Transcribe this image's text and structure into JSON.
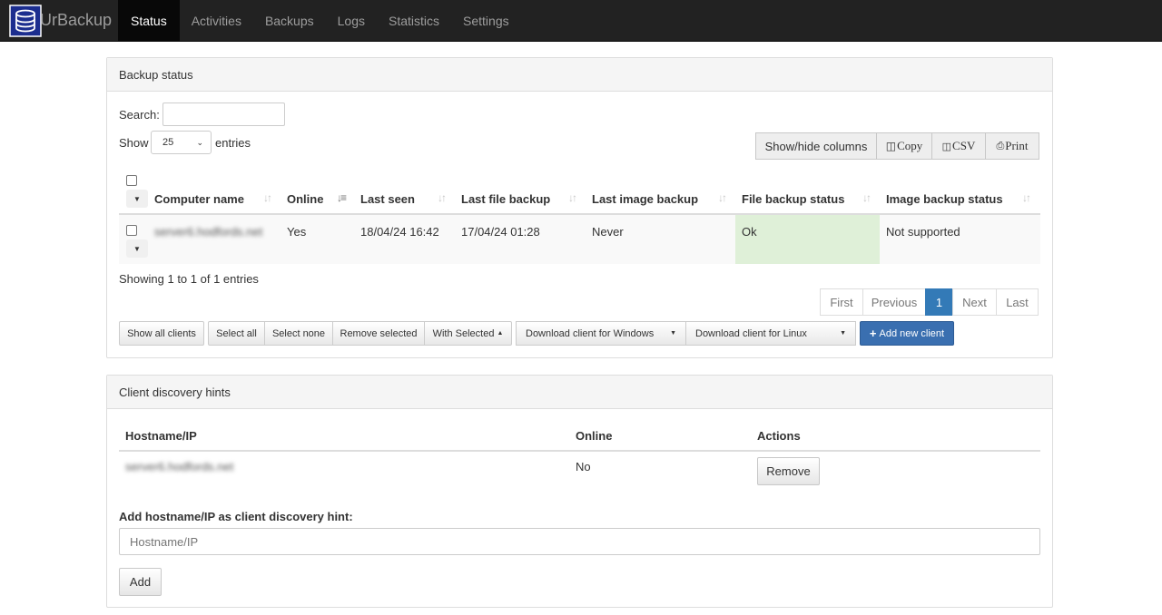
{
  "app": {
    "name": "UrBackup",
    "logo_icon": "database-icon"
  },
  "nav": {
    "items": [
      {
        "label": "Status",
        "active": true
      },
      {
        "label": "Activities",
        "active": false
      },
      {
        "label": "Backups",
        "active": false
      },
      {
        "label": "Logs",
        "active": false
      },
      {
        "label": "Statistics",
        "active": false
      },
      {
        "label": "Settings",
        "active": false
      }
    ]
  },
  "backup_status": {
    "title": "Backup status",
    "search_label": "Search:",
    "search_value": "",
    "show_label": "Show",
    "entries_label": "entries",
    "page_length": "25",
    "buttons": {
      "show_hide": "Show/hide columns",
      "copy": "Copy",
      "csv": "CSV",
      "print": "Print"
    },
    "columns": [
      "Computer name",
      "Online",
      "Last seen",
      "Last file backup",
      "Last image backup",
      "File backup status",
      "Image backup status"
    ],
    "rows": [
      {
        "computer_name": "server6.hodfords.net",
        "online": "Yes",
        "last_seen": "18/04/24 16:42",
        "last_file_backup": "17/04/24 01:28",
        "last_image_backup": "Never",
        "file_backup_status": "Ok",
        "image_backup_status": "Not supported"
      }
    ],
    "info": "Showing 1 to 1 of 1 entries",
    "pager": {
      "first": "First",
      "previous": "Previous",
      "current": "1",
      "next": "Next",
      "last": "Last"
    },
    "actions": {
      "show_all": "Show all clients",
      "select_all": "Select all",
      "select_none": "Select none",
      "remove_selected": "Remove selected",
      "with_selected": "With Selected",
      "download_windows": "Download client for Windows",
      "download_linux": "Download client for Linux",
      "add_client": "Add new client"
    }
  },
  "discovery": {
    "title": "Client discovery hints",
    "columns": [
      "Hostname/IP",
      "Online",
      "Actions"
    ],
    "rows": [
      {
        "hostname": "server6.hodfords.net",
        "online": "No",
        "action": "Remove"
      }
    ],
    "add_label": "Add hostname/IP as client discovery hint:",
    "input_placeholder": "Hostname/IP",
    "add_button": "Add"
  },
  "colors": {
    "navbar": "#222222",
    "status_ok_bg": "#dff0d8",
    "primary": "#3a6fb0",
    "pager_active": "#337ab7"
  }
}
